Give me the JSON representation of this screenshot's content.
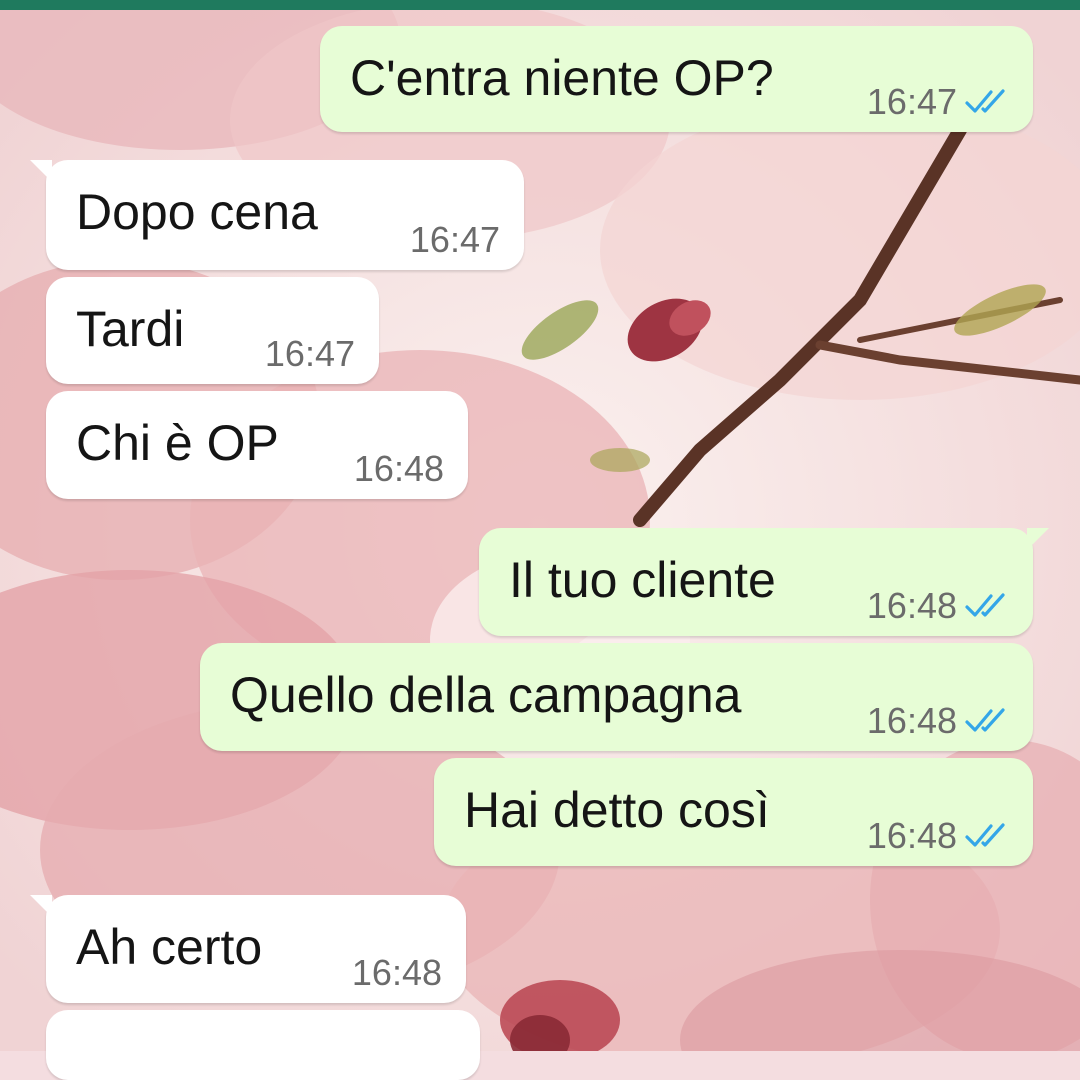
{
  "chat": {
    "messages": [
      {
        "text": "C'entra niente OP?",
        "time": "16:47",
        "status": "read"
      },
      {
        "text": "Dopo cena",
        "time": "16:47"
      },
      {
        "text": "Tardi",
        "time": "16:47"
      },
      {
        "text": "Chi è OP",
        "time": "16:48"
      },
      {
        "text": "Il tuo cliente",
        "time": "16:48",
        "status": "read"
      },
      {
        "text": "Quello della campagna",
        "time": "16:48",
        "status": "read"
      },
      {
        "text": "Hai detto così",
        "time": "16:48",
        "status": "read"
      },
      {
        "text": "Ah certo",
        "time": "16:48"
      }
    ]
  },
  "theme": {
    "top_bar": "#1f7a5e",
    "incoming_bubble": "#ffffff",
    "outgoing_bubble": "#e7fdd6",
    "read_check": "#34a6e8",
    "wallpaper_petal": "#eab3b6",
    "wallpaper_branch": "#5a3326"
  },
  "icons": {
    "read_receipt": "double-check-icon",
    "wallpaper": "pink-blossom-wallpaper"
  }
}
